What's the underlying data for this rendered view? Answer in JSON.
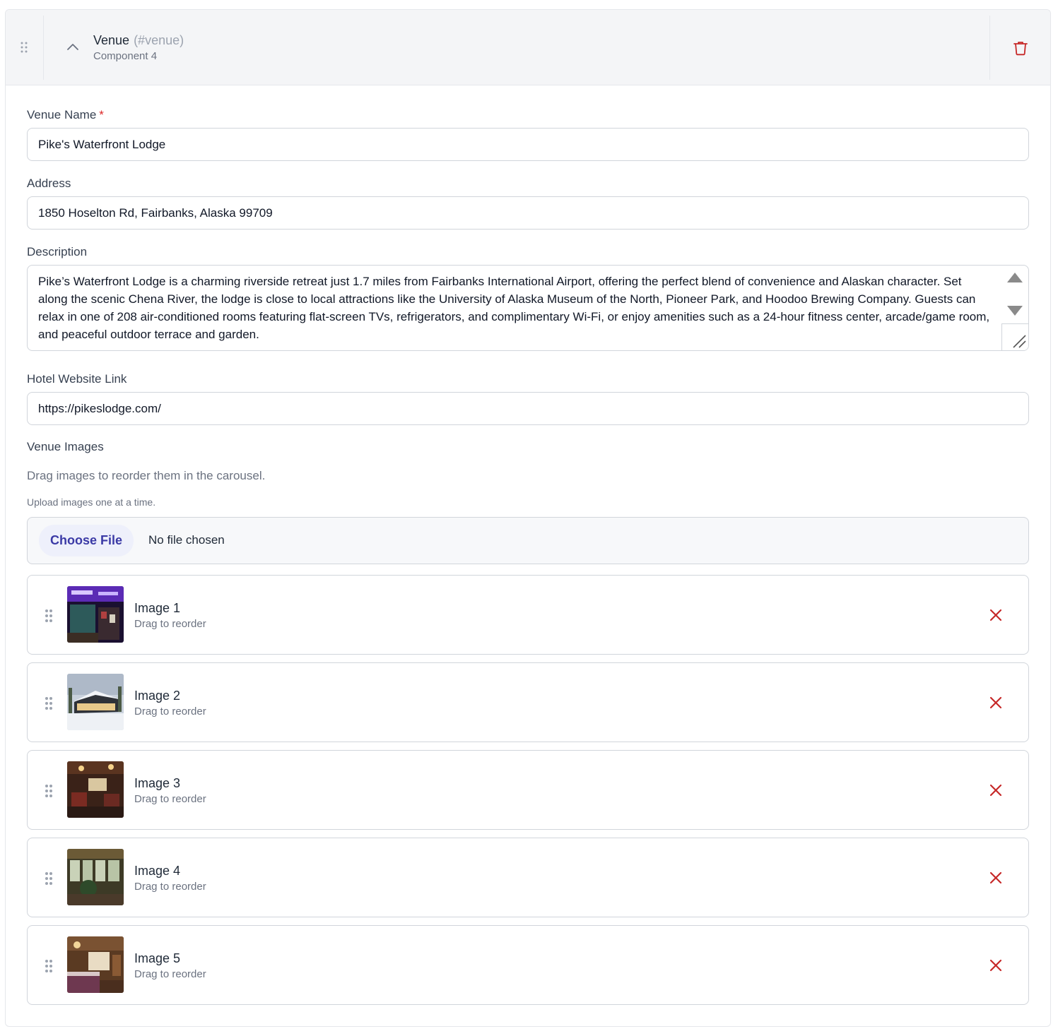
{
  "component": {
    "title": "Venue",
    "anchor": "(#venue)",
    "subtitle": "Component 4"
  },
  "fields": {
    "venue_name": {
      "label": "Venue Name",
      "required_mark": "*",
      "value": "Pike's Waterfront Lodge"
    },
    "address": {
      "label": "Address",
      "value": "1850 Hoselton Rd, Fairbanks, Alaska 99709"
    },
    "description": {
      "label": "Description",
      "value": "Pike’s Waterfront Lodge is a charming riverside retreat just 1.7 miles from Fairbanks International Airport, offering the perfect blend of convenience and Alaskan character. Set along the scenic Chena River, the lodge is close to local attractions like the University of Alaska Museum of the North, Pioneer Park, and Hoodoo Brewing Company. Guests can relax in one of 208 air-conditioned rooms featuring flat-screen TVs, refrigerators, and complimentary Wi-Fi, or enjoy amenities such as a 24-hour fitness center, arcade/game room, and peaceful outdoor terrace and garden."
    },
    "website": {
      "label": "Hotel Website Link",
      "value": "https://pikeslodge.com/"
    }
  },
  "images_section": {
    "title": "Venue Images",
    "hint": "Drag images to reorder them in the carousel.",
    "upload_hint": "Upload images one at a time.",
    "choose_file_label": "Choose File",
    "file_status": "No file chosen",
    "items": [
      {
        "name": "Image 1",
        "subtitle": "Drag to reorder"
      },
      {
        "name": "Image 2",
        "subtitle": "Drag to reorder"
      },
      {
        "name": "Image 3",
        "subtitle": "Drag to reorder"
      },
      {
        "name": "Image 4",
        "subtitle": "Drag to reorder"
      },
      {
        "name": "Image 5",
        "subtitle": "Drag to reorder"
      }
    ]
  },
  "colors": {
    "accent": "#3b3aa6",
    "danger": "#c62828",
    "header_bg": "#f4f5f7"
  },
  "icons": {
    "drag": "drag-handle-icon",
    "collapse": "chevron-up-icon",
    "delete": "trash-icon",
    "remove": "close-icon"
  }
}
